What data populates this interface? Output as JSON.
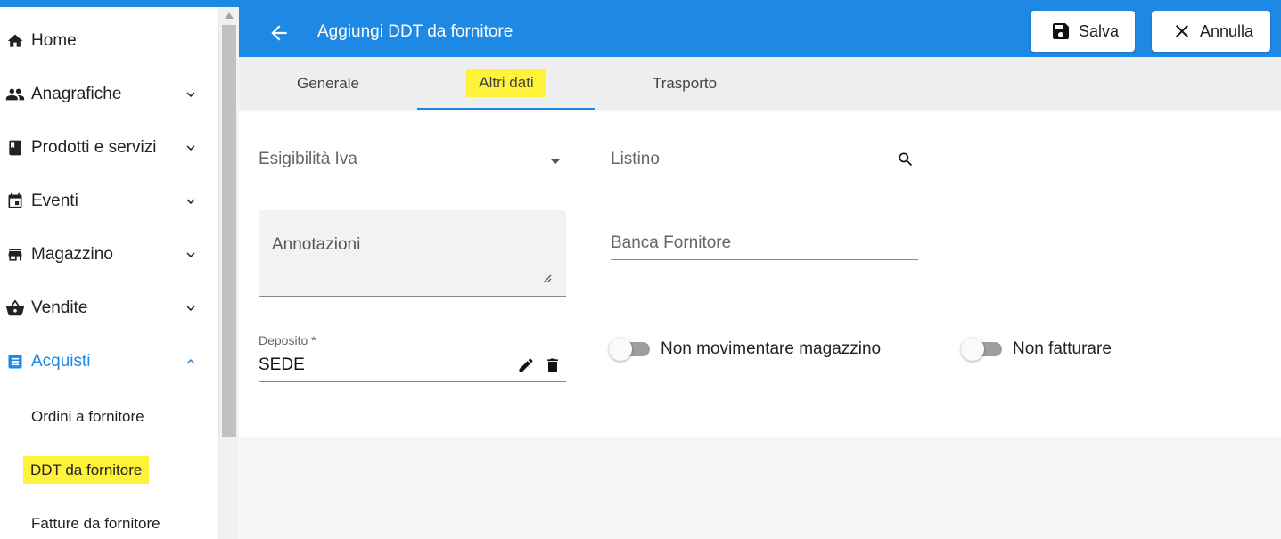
{
  "header": {
    "title": "Aggiungi DDT da fornitore",
    "save_label": "Salva",
    "cancel_label": "Annulla",
    "color": "#1e88e5"
  },
  "sidebar": {
    "items": [
      {
        "label": "Home",
        "icon": "home-icon"
      },
      {
        "label": "Anagrafiche",
        "icon": "people-icon"
      },
      {
        "label": "Prodotti e servizi",
        "icon": "book-icon"
      },
      {
        "label": "Eventi",
        "icon": "calendar-icon"
      },
      {
        "label": "Magazzino",
        "icon": "store-icon"
      },
      {
        "label": "Vendite",
        "icon": "basket-icon"
      },
      {
        "label": "Acquisti",
        "icon": "list-icon",
        "active": true
      }
    ],
    "sub_items": [
      {
        "label": "Ordini a fornitore"
      },
      {
        "label": "DDT da fornitore",
        "highlighted": true
      },
      {
        "label": "Fatture da fornitore"
      }
    ]
  },
  "tabs": [
    {
      "label": "Generale"
    },
    {
      "label": "Altri dati",
      "active": true
    },
    {
      "label": "Trasporto"
    }
  ],
  "form": {
    "esigibilita_iva": {
      "placeholder": "Esigibilità Iva"
    },
    "listino": {
      "placeholder": "Listino"
    },
    "annotazioni": {
      "placeholder": "Annotazioni"
    },
    "banca_fornitore": {
      "placeholder": "Banca Fornitore"
    },
    "deposito": {
      "label": "Deposito *",
      "value": "SEDE"
    },
    "non_movimentare_magazzino": {
      "label": "Non movimentare magazzino",
      "checked": false
    },
    "non_fatturare": {
      "label": "Non fatturare",
      "checked": false
    }
  }
}
